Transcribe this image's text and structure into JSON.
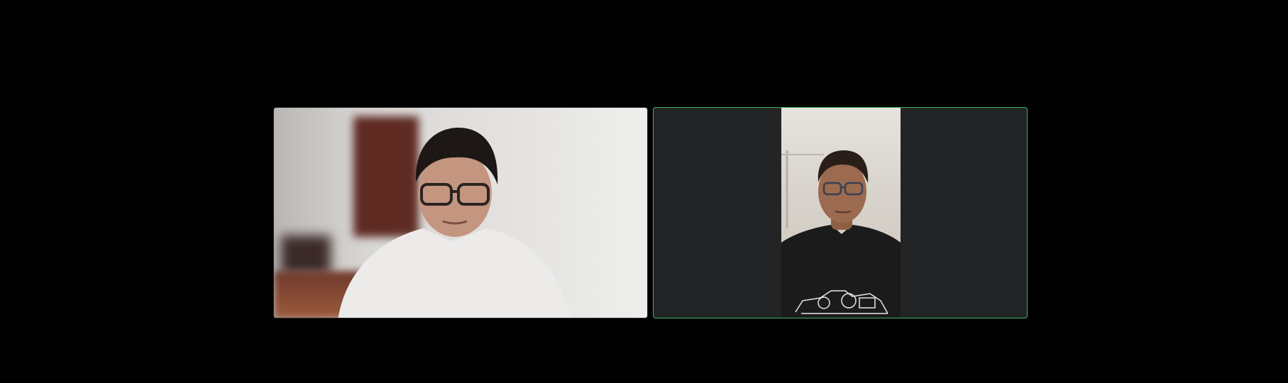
{
  "meeting": {
    "participants": [
      {
        "tile": "left",
        "active_speaker": false
      },
      {
        "tile": "right",
        "active_speaker": true
      }
    ]
  },
  "colors": {
    "background": "#000000",
    "tile_empty": "#232425",
    "active_speaker_border": "#3fb35f"
  },
  "icons": {
    "left_participant": "person-video-feed",
    "right_participant": "person-video-feed"
  }
}
